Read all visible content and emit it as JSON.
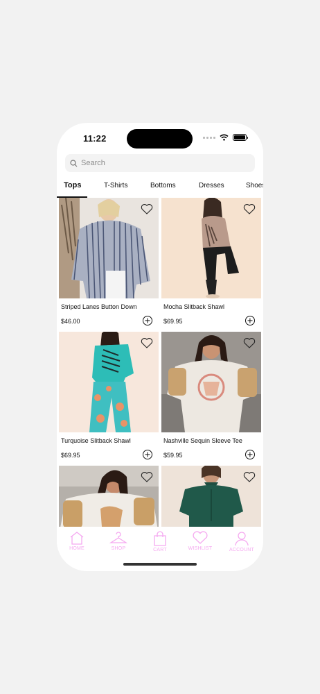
{
  "status_bar": {
    "time": "11:22"
  },
  "search": {
    "placeholder": "Search"
  },
  "categories": [
    "Tops",
    "T-Shirts",
    "Bottoms",
    "Dresses",
    "Shoes"
  ],
  "products": [
    {
      "name": "Striped Lanes Button Down",
      "price": "$46.00"
    },
    {
      "name": "Mocha Slitback Shawl",
      "price": "$69.95"
    },
    {
      "name": "Turquoise Slitback Shawl",
      "price": "$69.95"
    },
    {
      "name": "Nashville Sequin Sleeve Tee",
      "price": "$59.95"
    },
    {
      "name": "",
      "price": ""
    },
    {
      "name": "",
      "price": ""
    }
  ],
  "tab_bar": [
    {
      "label": "HOME",
      "icon": "home-icon"
    },
    {
      "label": "SHOP",
      "icon": "hanger-icon"
    },
    {
      "label": "CART",
      "icon": "bag-icon"
    },
    {
      "label": "WISHLIST",
      "icon": "heart-icon"
    },
    {
      "label": "ACCOUNT",
      "icon": "person-icon"
    }
  ],
  "colors": {
    "tab_bar_accent": "#f5a9f0",
    "background": "#f2f2f2"
  }
}
